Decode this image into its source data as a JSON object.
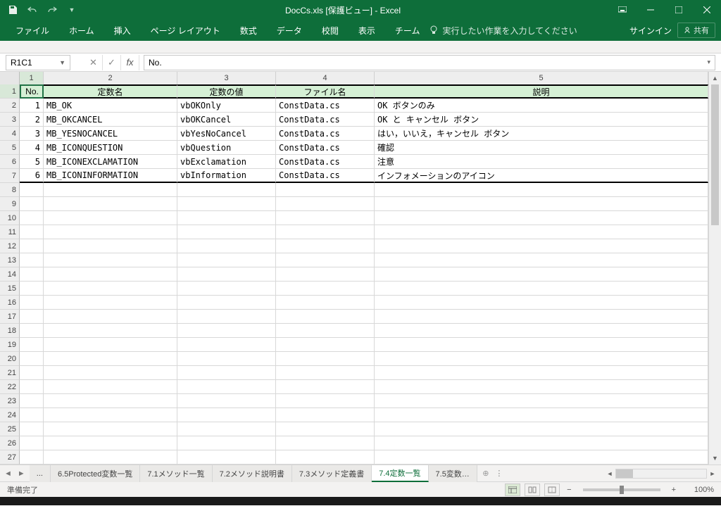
{
  "title": "DocCs.xls  [保護ビュー] - Excel",
  "ribbon": {
    "file": "ファイル",
    "home": "ホーム",
    "insert": "挿入",
    "layout": "ページ レイアウト",
    "formulas": "数式",
    "data": "データ",
    "review": "校閲",
    "view": "表示",
    "team": "チーム",
    "tellme": "実行したい作業を入力してください",
    "signin": "サインイン",
    "share": "共有"
  },
  "namebox": "R1C1",
  "formula": "No.",
  "col_headers": [
    "1",
    "2",
    "3",
    "4",
    "5"
  ],
  "table": {
    "headers": {
      "no": "No.",
      "name": "定数名",
      "value": "定数の値",
      "file": "ファイル名",
      "desc": "説明"
    },
    "rows": [
      {
        "no": "1",
        "name": "MB_OK",
        "value": "vbOKOnly",
        "file": "ConstData.cs",
        "desc": "OK ボタンのみ"
      },
      {
        "no": "2",
        "name": "MB_OKCANCEL",
        "value": "vbOKCancel",
        "file": "ConstData.cs",
        "desc": "OK と キャンセル ボタン"
      },
      {
        "no": "3",
        "name": "MB_YESNOCANCEL",
        "value": "vbYesNoCancel",
        "file": "ConstData.cs",
        "desc": "はい，いいえ，キャンセル ボタン"
      },
      {
        "no": "4",
        "name": "MB_ICONQUESTION",
        "value": "vbQuestion",
        "file": "ConstData.cs",
        "desc": "確認"
      },
      {
        "no": "5",
        "name": "MB_ICONEXCLAMATION",
        "value": "vbExclamation",
        "file": "ConstData.cs",
        "desc": "注意"
      },
      {
        "no": "6",
        "name": "MB_ICONINFORMATION",
        "value": "vbInformation",
        "file": "ConstData.cs",
        "desc": "インフォメーションのアイコン"
      }
    ]
  },
  "sheet_tabs": {
    "ellipsis": "...",
    "t0": "6.5Protected変数一覧",
    "t1": "7.1メソッド一覧",
    "t2": "7.2メソッド説明書",
    "t3": "7.3メソッド定義書",
    "t4": "7.4定数一覧",
    "t5": "7.5変数…"
  },
  "status": {
    "ready": "準備完了",
    "zoom": "100%"
  }
}
